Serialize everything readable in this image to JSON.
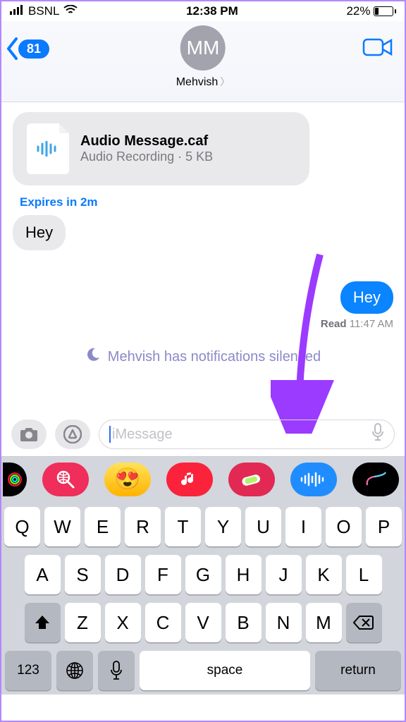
{
  "status": {
    "carrier": "BSNL",
    "time": "12:38 PM",
    "battery_pct": "22%",
    "battery_fill": 22
  },
  "nav": {
    "back_count": "81",
    "avatar_initials": "MM",
    "contact_name": "Mehvish"
  },
  "conversation": {
    "file": {
      "title": "Audio Message.caf",
      "subtitle": "Audio Recording · 5 KB"
    },
    "expires": "Expires in 2m",
    "incoming_text": "Hey",
    "outgoing_text": "Hey",
    "receipt_status": "Read",
    "receipt_time": "11:47 AM",
    "silenced": "Mehvish has notifications silenced"
  },
  "compose": {
    "placeholder": "iMessage"
  },
  "appstrip": {
    "icons": [
      "activity",
      "search",
      "memoji",
      "music",
      "fitness",
      "audio",
      "digital-touch"
    ],
    "colors": [
      "#000",
      "#ef2e5b",
      "#ffd000",
      "#fa233b",
      "#e22953",
      "#1f8dff",
      "#000"
    ]
  },
  "keyboard": {
    "row1": [
      "Q",
      "W",
      "E",
      "R",
      "T",
      "Y",
      "U",
      "I",
      "O",
      "P"
    ],
    "row2": [
      "A",
      "S",
      "D",
      "F",
      "G",
      "H",
      "J",
      "K",
      "L"
    ],
    "row3": [
      "Z",
      "X",
      "C",
      "V",
      "B",
      "N",
      "M"
    ],
    "num": "123",
    "space": "space",
    "return": "return"
  },
  "annotation": {
    "color": "#9b3bff"
  }
}
